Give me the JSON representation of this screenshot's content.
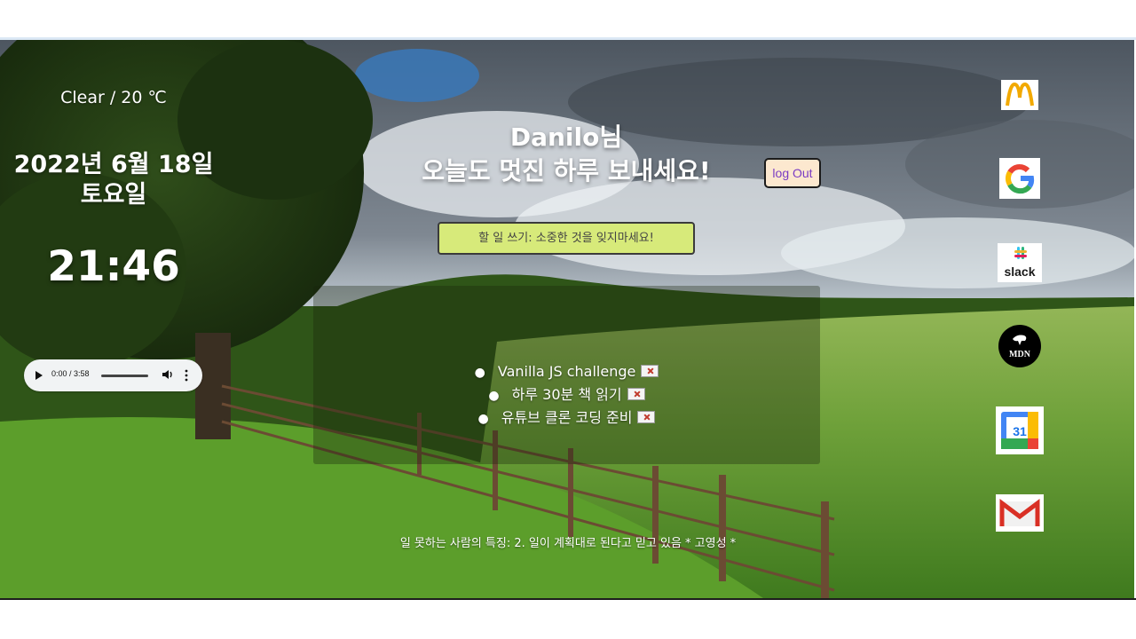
{
  "weather": {
    "text": "Clear / 20 ℃"
  },
  "date": {
    "line1": "2022년 6월 18일",
    "line2": "토요일"
  },
  "clock": {
    "time": "21:46"
  },
  "audio": {
    "time": "0:00 / 3:58"
  },
  "greeting": {
    "line1": "Danilo님",
    "line2": "오늘도 멋진 하루 보내세요!"
  },
  "logout": {
    "label": "log Out"
  },
  "todo": {
    "placeholder": "할 일 쓰기: 소중한 것을 잊지마세요!",
    "items": [
      "Vanilla JS challenge",
      "하루 30분 책 읽기",
      "유튜브 클론 코딩 준비"
    ]
  },
  "quote": {
    "text": "일 못하는 사람의 특징: 2. 일이 계획대로 된다고 믿고 있음 * 고영성 *"
  },
  "shortcuts": [
    {
      "icon": "mcdonalds-icon"
    },
    {
      "icon": "google-icon"
    },
    {
      "icon": "slack-icon",
      "label": "slack"
    },
    {
      "icon": "mdn-icon",
      "label": "MDN"
    },
    {
      "icon": "google-calendar-icon",
      "label": "31"
    },
    {
      "icon": "gmail-icon"
    }
  ],
  "colors": {
    "input_bg": "#d7ea7a",
    "logout_bg": "#fce8cf",
    "logout_text": "#7a3cc4"
  }
}
